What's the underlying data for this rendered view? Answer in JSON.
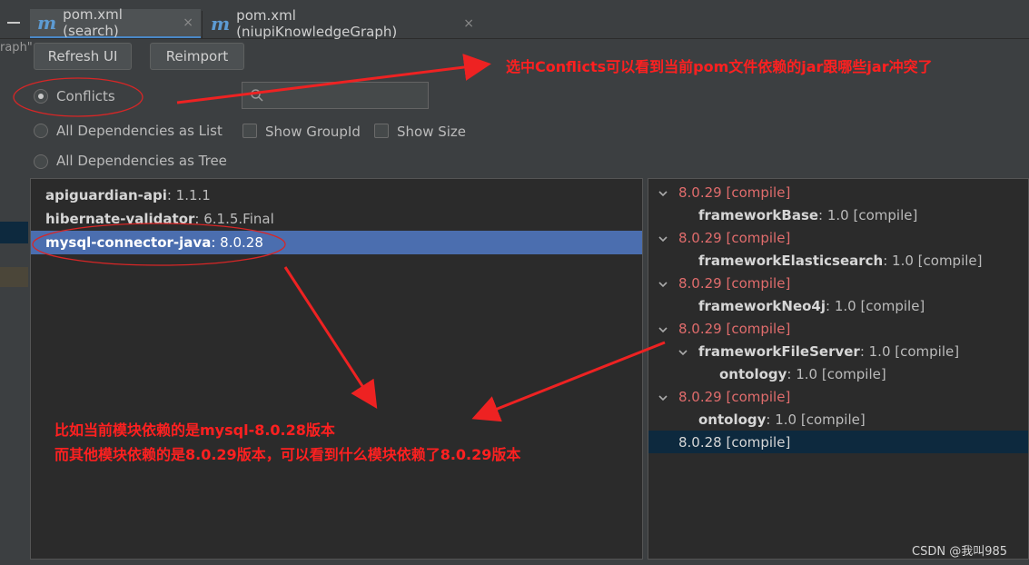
{
  "tabs": [
    {
      "icon": "m",
      "label": "pom.xml (search)",
      "close": "×"
    },
    {
      "icon": "m",
      "label": "pom.xml (niupiKnowledgeGraph)",
      "close": "×"
    }
  ],
  "left_cut_text": "raph\"",
  "toolbar": {
    "refresh_label": "Refresh UI",
    "reimport_label": "Reimport"
  },
  "options": {
    "conflicts_label": "Conflicts",
    "all_list_label": "All Dependencies as List",
    "all_tree_label": "All Dependencies as Tree",
    "show_groupid_label": "Show GroupId",
    "show_size_label": "Show Size",
    "search_placeholder": ""
  },
  "conflicts": [
    {
      "name": "apiguardian-api",
      "version": " : 1.1.1"
    },
    {
      "name": "hibernate-validator",
      "version": " : 6.1.5.Final"
    },
    {
      "name": "mysql-connector-java",
      "version": " : 8.0.28"
    }
  ],
  "tree": [
    {
      "text": "8.0.29 [compile]"
    },
    {
      "name": "frameworkBase",
      "rest": " : 1.0 [compile]"
    },
    {
      "text": "8.0.29 [compile]"
    },
    {
      "name": "frameworkElasticsearch",
      "rest": " : 1.0 [compile]"
    },
    {
      "text": "8.0.29 [compile]"
    },
    {
      "name": "frameworkNeo4j",
      "rest": " : 1.0 [compile]"
    },
    {
      "text": "8.0.29 [compile]"
    },
    {
      "name": "frameworkFileServer",
      "rest": " : 1.0 [compile]"
    },
    {
      "name": "ontology",
      "rest": " : 1.0 [compile]"
    },
    {
      "text": "8.0.29 [compile]"
    },
    {
      "name": "ontology",
      "rest": " : 1.0 [compile]"
    },
    {
      "text": "8.0.28 [compile]"
    }
  ],
  "annotations": {
    "top": "选中Conflicts可以看到当前pom文件依赖的jar跟哪些jar冲突了",
    "bottom_line1": "比如当前模块依赖的是mysql-8.0.28版本",
    "bottom_line2": "而其他模块依赖的是8.0.29版本，可以看到什么模块依赖了8.0.29版本"
  },
  "watermark": "CSDN @我叫985",
  "colors": {
    "accent": "#4b6eaf",
    "conflict_red": "#e06c6c",
    "annotation_red": "#ff2020"
  }
}
